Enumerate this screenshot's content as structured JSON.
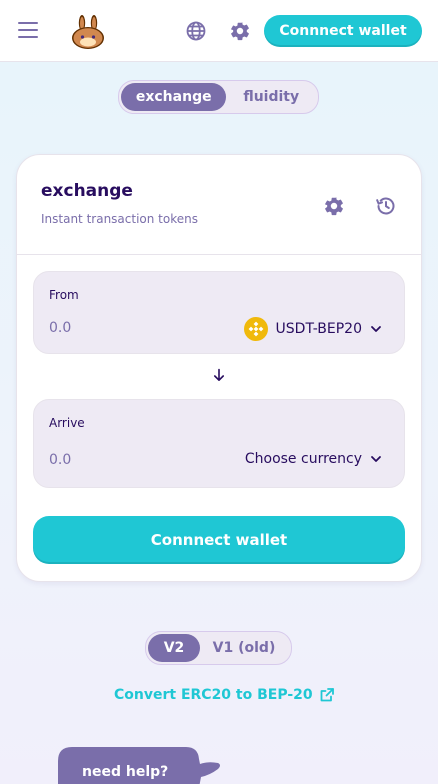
{
  "header": {
    "connect_label": "Connnect wallet",
    "icons": [
      "menu-icon",
      "bunny-logo-icon",
      "globe-icon",
      "gear-icon"
    ]
  },
  "main_toggle": {
    "options": [
      "exchange",
      "fluidity"
    ],
    "active_index": 0
  },
  "card": {
    "title": "exchange",
    "subtitle": "Instant transaction tokens",
    "from": {
      "label": "From",
      "placeholder": "0.0",
      "value": "",
      "token": "USDT-BEP20",
      "token_icon": "bnb-coin-icon"
    },
    "arrive": {
      "label": "Arrive",
      "placeholder": "0.0",
      "value": "",
      "token": "Choose currency"
    },
    "connect_label": "Connnect wallet"
  },
  "version_toggle": {
    "options": [
      "V2",
      "V1 (old)"
    ],
    "active_index": 0
  },
  "convert_link": {
    "label": "Convert ERC20 to BEP-20"
  },
  "help": {
    "label": "need help?"
  },
  "colors": {
    "accent": "#1fc7d4",
    "primary_text": "#280d5f",
    "secondary": "#7a6eaa",
    "input_bg": "#eeeaf4",
    "bnb": "#f0b90b"
  }
}
